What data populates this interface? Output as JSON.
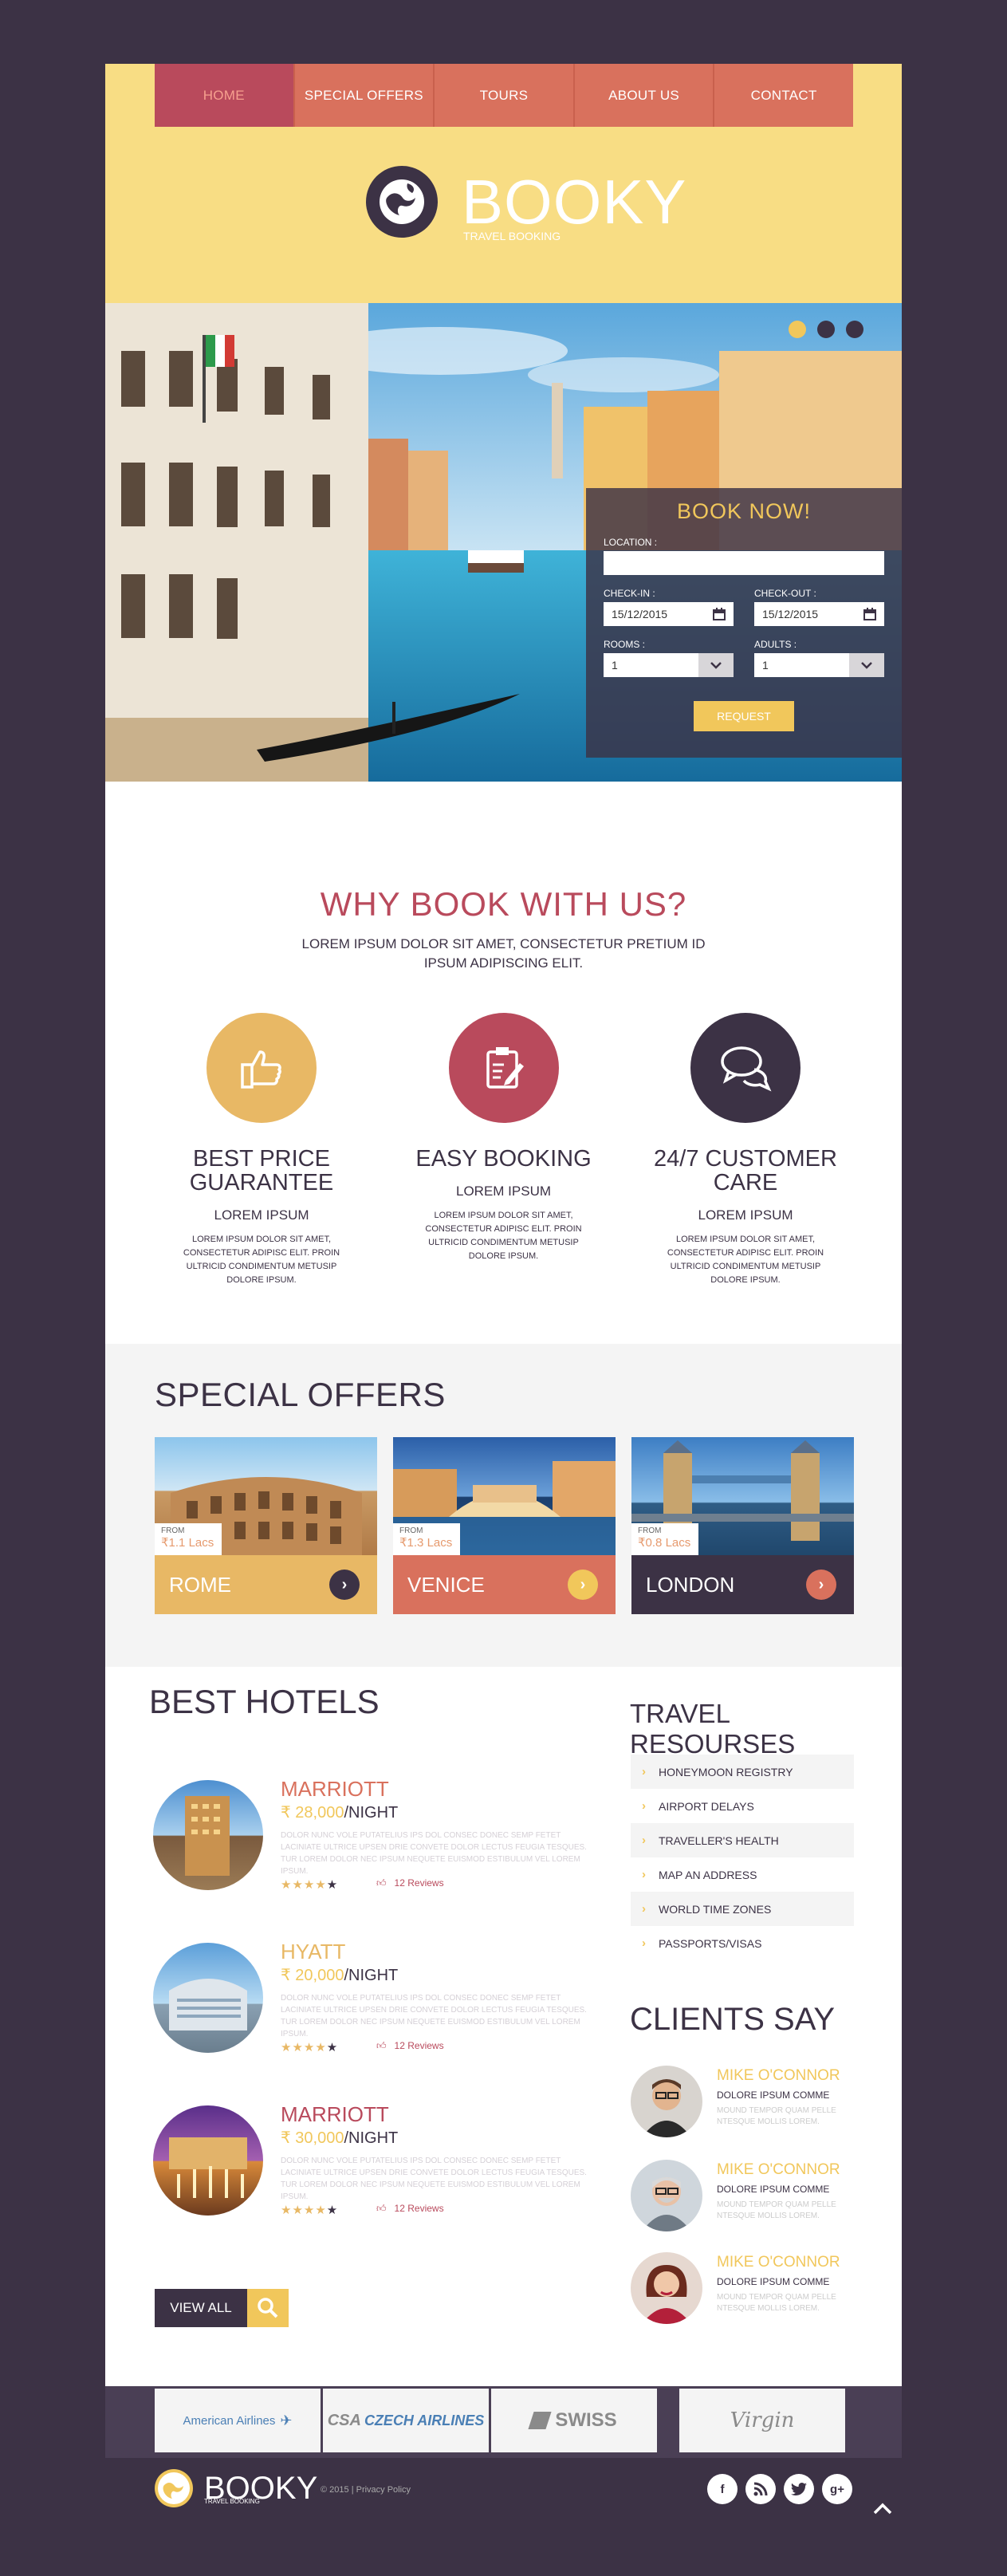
{
  "nav": {
    "items": [
      "HOME",
      "SPECIAL OFFERS",
      "TOURS",
      "ABOUT US",
      "CONTACT"
    ]
  },
  "brand": {
    "name": "BOOKY",
    "tagline": "TRAVEL BOOKING"
  },
  "booking": {
    "title": "BOOK NOW!",
    "location_label": "LOCATION :",
    "location_value": "",
    "checkin_label": "CHECK-IN :",
    "checkin_value": "15/12/2015",
    "checkout_label": "CHECK-OUT :",
    "checkout_value": "15/12/2015",
    "rooms_label": "ROOMS :",
    "rooms_value": "1",
    "adults_label": "ADULTS :",
    "adults_value": "1",
    "request_label": "REQUEST"
  },
  "why": {
    "title": "WHY BOOK WITH US?",
    "lead": "LOREM IPSUM DOLOR SIT AMET, CONSECTETUR PRETIUM ID IPSUM ADIPISCING ELIT.",
    "features": [
      {
        "title": "BEST PRICE GUARANTEE",
        "subtitle": "LOREM IPSUM",
        "text": "LOREM IPSUM DOLOR SIT AMET, CONSECTETUR ADIPISC ELIT. PROIN ULTRICID CONDIMENTUM METUSIP DOLORE IPSUM.",
        "icon": "thumbs-up-icon",
        "color": "#e8b865"
      },
      {
        "title": "EASY BOOKING",
        "subtitle": "LOREM IPSUM",
        "text": "LOREM IPSUM DOLOR SIT AMET, CONSECTETUR ADIPISC ELIT. PROIN ULTRICID CONDIMENTUM METUSIP DOLORE IPSUM.",
        "icon": "clipboard-icon",
        "color": "#b94a5c"
      },
      {
        "title": "24/7 CUSTOMER CARE",
        "subtitle": "LOREM IPSUM",
        "text": "LOREM IPSUM DOLOR SIT AMET, CONSECTETUR ADIPISC ELIT. PROIN ULTRICID CONDIMENTUM METUSIP DOLORE IPSUM.",
        "icon": "chat-bubbles-icon",
        "color": "#3c3245"
      }
    ]
  },
  "offers": {
    "title": "SPECIAL OFFERS",
    "items": [
      {
        "city": "ROME",
        "from": "FROM",
        "price": "₹1.1 Lacs",
        "color": "#e8b865"
      },
      {
        "city": "VENICE",
        "from": "FROM",
        "price": "₹1.3 Lacs",
        "color": "#d9715d"
      },
      {
        "city": "LONDON",
        "from": "FROM",
        "price": "₹0.8 Lacs",
        "color": "#3c3245"
      }
    ]
  },
  "hotels": {
    "title": "BEST HOTELS",
    "items": [
      {
        "name": "MARRIOTT",
        "price": "₹ 28,000",
        "unit": "/NIGHT",
        "desc": "DOLOR NUNC VOLE PUTATELIUS IPS DOL CONSEC DONEC SEMP FETET LACINIATE ULTRICE UPSEN DRIE CONVETE DOLOR LECTUS FEUGIA TESQUES. TUR LOREM DOLOR NEC IPSUM NEQUETE EUISMOD ESTIBULUM VEL LOREM IPSUM.",
        "stars": "★★★★★",
        "reviews": "12 Reviews",
        "name_color": "#d9715d"
      },
      {
        "name": "HYATT",
        "price": "₹ 20,000",
        "unit": "/NIGHT",
        "desc": "DOLOR NUNC VOLE PUTATELIUS IPS DOL CONSEC DONEC SEMP FETET LACINIATE ULTRICE UPSEN DRIE CONVETE DOLOR LECTUS FEUGIA TESQUES. TUR LOREM DOLOR NEC IPSUM NEQUETE EUISMOD ESTIBULUM VEL LOREM IPSUM.",
        "stars": "★★★★★",
        "reviews": "12 Reviews",
        "name_color": "#e8b865"
      },
      {
        "name": "MARRIOTT",
        "price": "₹ 30,000",
        "unit": "/NIGHT",
        "desc": "DOLOR NUNC VOLE PUTATELIUS IPS DOL CONSEC DONEC SEMP FETET LACINIATE ULTRICE UPSEN DRIE CONVETE DOLOR LECTUS FEUGIA TESQUES. TUR LOREM DOLOR NEC IPSUM NEQUETE EUISMOD ESTIBULUM VEL LOREM IPSUM.",
        "stars": "★★★★★",
        "reviews": "12 Reviews",
        "name_color": "#b94a5c"
      }
    ],
    "view_all": "VIEW ALL"
  },
  "resources": {
    "title": "TRAVEL RESOURSES",
    "items": [
      "HONEYMOON REGISTRY",
      "AIRPORT DELAYS",
      "TRAVELLER'S HEALTH",
      "MAP AN ADDRESS",
      "WORLD TIME ZONES",
      "PASSPORTS/VISAS"
    ]
  },
  "clients": {
    "title": "CLIENTS SAY",
    "items": [
      {
        "name": "MIKE O'CONNOR",
        "role": "DOLORE IPSUM COMME",
        "text": "MOUND TEMPOR QUAM PELLE NTESQUE MOLLIS LOREM."
      },
      {
        "name": "MIKE O'CONNOR",
        "role": "DOLORE IPSUM COMME",
        "text": "MOUND TEMPOR QUAM PELLE NTESQUE MOLLIS LOREM."
      },
      {
        "name": "MIKE O'CONNOR",
        "role": "DOLORE IPSUM COMME",
        "text": "MOUND TEMPOR QUAM PELLE NTESQUE MOLLIS LOREM."
      }
    ]
  },
  "partners": [
    "American Airlines",
    "CZECH AIRLINES",
    "SWISS",
    "Virgin"
  ],
  "footer": {
    "name": "BOOKY",
    "tagline": "TRAVEL BOOKING",
    "copyright": "© 2015  |  Privacy Policy",
    "social": [
      "f",
      "rss",
      "t",
      "g+"
    ]
  }
}
